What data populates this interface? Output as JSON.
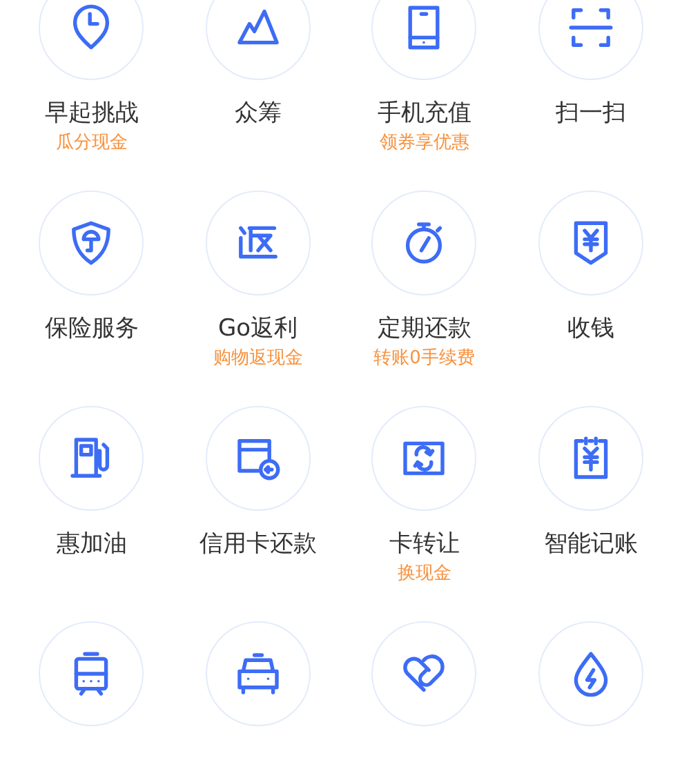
{
  "services": [
    {
      "kind": "labeled",
      "label": "早起挑战",
      "promo": "瓜分现金"
    },
    {
      "kind": "labeled",
      "label": "众筹"
    },
    {
      "kind": "labeled",
      "label": "手机充值",
      "promo": "领券享优惠"
    },
    {
      "kind": "labeled",
      "label": "扫一扫"
    },
    {
      "kind": "labeled",
      "label": "保险服务"
    },
    {
      "kind": "labeled",
      "label": "Go返利",
      "promo": "购物返现金"
    },
    {
      "kind": "labeled",
      "label": "定期还款",
      "promo": "转账0手续费"
    },
    {
      "kind": "labeled",
      "label": "收钱"
    },
    {
      "kind": "labeled",
      "label": "惠加油"
    },
    {
      "kind": "labeled",
      "label": "信用卡还款"
    },
    {
      "kind": "labeled",
      "label": "卡转让",
      "promo": "换现金"
    },
    {
      "kind": "labeled",
      "label": "智能记账"
    },
    {
      "kind": "icon_only"
    },
    {
      "kind": "icon_only"
    },
    {
      "kind": "icon_only"
    },
    {
      "kind": "icon_only"
    }
  ]
}
